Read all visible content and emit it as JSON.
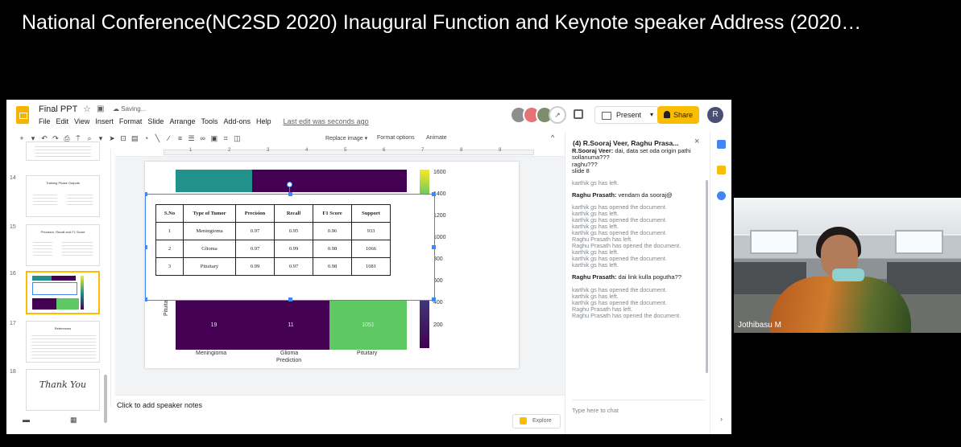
{
  "video": {
    "title": "National Conference(NC2SD 2020) Inaugural Function and Keynote speaker Address (2020…",
    "participant_name": "Jothibasu M"
  },
  "app": {
    "doc_title": "Final PPT",
    "saving": "Saving...",
    "menu": [
      "File",
      "Edit",
      "View",
      "Insert",
      "Format",
      "Slide",
      "Arrange",
      "Tools",
      "Add-ons",
      "Help"
    ],
    "last_edit": "Last edit was seconds ago",
    "present_label": "Present",
    "share_label": "Share",
    "user_initial": "R",
    "replace_image": "Replace image ▾",
    "format_options": "Format options",
    "animate": "Animate"
  },
  "ruler": [
    "1",
    "2",
    "3",
    "4",
    "5",
    "6",
    "7",
    "8",
    "9"
  ],
  "filmstrip": {
    "slides": [
      {
        "num": "14",
        "title": "Training Phase Outputs"
      },
      {
        "num": "15",
        "title": "Precision, Recall and F1 Score"
      },
      {
        "num": "16",
        "title": ""
      },
      {
        "num": "17",
        "title": "References"
      },
      {
        "num": "18",
        "title": "Thank You"
      }
    ]
  },
  "slide": {
    "table": {
      "headers": [
        "S.No",
        "Type of Tumor",
        "Precision",
        "Recall",
        "F1 Score",
        "Support"
      ],
      "rows": [
        [
          "1",
          "Meningioma",
          "0.97",
          "0.95",
          "0.96",
          "933"
        ],
        [
          "2",
          "Glioma",
          "0.97",
          "0.99",
          "0.98",
          "1066"
        ],
        [
          "3",
          "Pituitary",
          "0.99",
          "0.97",
          "0.98",
          "1081"
        ]
      ]
    },
    "heatmap": {
      "bottom_row": [
        "19",
        "11",
        "1051"
      ],
      "x_ticks": [
        "Meningioma",
        "Glioma",
        "Pituitary"
      ],
      "x_label": "Prediction",
      "y_tick": "Pituitary",
      "colorbar_ticks": [
        "1600",
        "1400",
        "1200",
        "1000",
        "800",
        "600",
        "400",
        "200"
      ]
    }
  },
  "notes": {
    "placeholder": "Click to add speaker notes",
    "explore_label": "Explore"
  },
  "chat": {
    "header": "(4) R.Sooraj Veer, Raghu Prasa...",
    "close": "×",
    "input_placeholder": "Type here to chat",
    "messages": [
      {
        "type": "user",
        "from": "R.Sooraj Veer:",
        "text": "dai, data set oda origin pathi sollanuma???"
      },
      {
        "type": "cont",
        "text": "raghu???"
      },
      {
        "type": "cont",
        "text": "slide 8"
      },
      {
        "type": "system",
        "lines": [
          "karthik gs has left."
        ]
      },
      {
        "type": "user",
        "from": "Raghu Prasath:",
        "text": "vendam da sooraj@"
      },
      {
        "type": "system",
        "lines": [
          "karthik gs has opened the document.",
          "karthik gs has left.",
          "karthik gs has opened the document.",
          "karthik gs has left.",
          "karthik gs has opened the document.",
          "Raghu Prasath has left.",
          "Raghu Prasath has opened the document.",
          "karthik gs has left.",
          "karthik gs has opened the document.",
          "karthik gs has left."
        ]
      },
      {
        "type": "user",
        "from": "Raghu Prasath:",
        "text": "dai link kulla pogutha??"
      },
      {
        "type": "system",
        "lines": [
          "karthik gs has opened the document.",
          "karthik gs has left.",
          "karthik gs has opened the document.",
          "Raghu Prasath has left.",
          "Raghu Prasath has opened the document."
        ]
      }
    ]
  }
}
